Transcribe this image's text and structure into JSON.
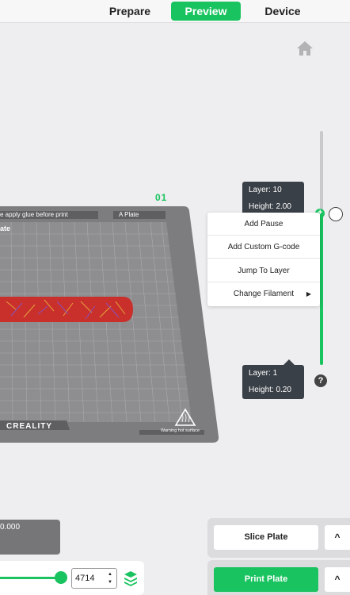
{
  "tabs": {
    "prepare": "Prepare",
    "preview": "Preview",
    "device": "Device"
  },
  "plate": {
    "number": "01",
    "note": "e apply glue before print",
    "label": "A Plate",
    "name": "ate",
    "brand": "CREALITY",
    "warning": "Warning hot surface"
  },
  "layer_top": {
    "layer": "Layer: 10",
    "height": "Height: 2.00"
  },
  "layer_bottom": {
    "layer": "Layer: 1",
    "height": "Height: 0.20"
  },
  "menu": {
    "add_pause": "Add Pause",
    "add_gcode": "Add Custom G-code",
    "jump_layer": "Jump To Layer",
    "change_filament": "Change Filament",
    "submenu_arrow": "▶"
  },
  "help": "?",
  "bottom_left": {
    "value": "0.000",
    "input": "4714"
  },
  "actions": {
    "slice": "Slice Plate",
    "print": "Print Plate",
    "caret": "^"
  },
  "colors": {
    "accent": "#19c35f",
    "tooltip": "#3a4047",
    "plate": "#7d7d80"
  }
}
